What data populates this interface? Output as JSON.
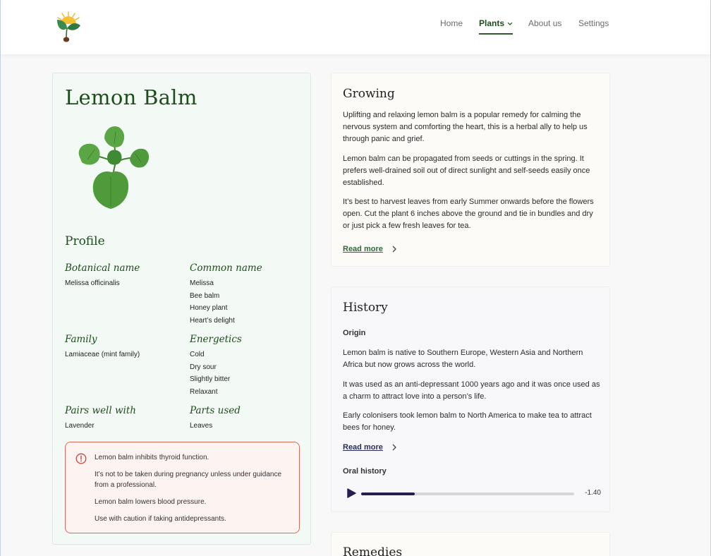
{
  "nav": {
    "items": [
      {
        "label": "Home",
        "active": false
      },
      {
        "label": "Plants",
        "active": true,
        "has_dropdown": true
      },
      {
        "label": "About us",
        "active": false
      },
      {
        "label": "Settings",
        "active": false
      }
    ]
  },
  "plant": {
    "name": "Lemon Balm",
    "profile_title": "Profile",
    "profile": {
      "botanical": {
        "label": "Botanical name",
        "values": [
          "Melissa officinalis"
        ]
      },
      "common": {
        "label": "Common name",
        "values": [
          "Melissa",
          "Bee balm",
          "Honey plant",
          "Heart’s delight"
        ]
      },
      "family": {
        "label": "Family",
        "values": [
          "Lamiaceae (mint family)"
        ]
      },
      "energetics": {
        "label": "Energetics",
        "values": [
          "Cold",
          "Dry sour",
          "Slightly bitter",
          "Relaxant"
        ]
      },
      "pairs": {
        "label": "Pairs well with",
        "values": [
          "Lavender"
        ]
      },
      "parts": {
        "label": "Parts used",
        "values": [
          "Leaves"
        ]
      }
    },
    "warnings": [
      "Lemon balm inhibits thyroid function.",
      "It’s not to be taken during pregnancy unless under guidance from a professional.",
      "Lemon balm lowers blood pressure.",
      "Use with caution if taking antidepressants."
    ]
  },
  "growing": {
    "title": "Growing",
    "paragraphs": [
      "Uplifting and relaxing lemon balm is a popular remedy for calming the nervous system and comforting the heart,  this is a herbal ally to help us through panic and grief.",
      "Lemon balm can be propagated from seeds or cuttings in the spring.  It prefers well-drained soil out of direct sunlight and self-seeds easily once established.",
      "It’s best to harvest leaves from early Summer onwards before the flowers open. Cut the plant 6 inches above the ground and tie in bundles and dry or just pick a few fresh leaves for tea."
    ],
    "read_more": "Read more"
  },
  "history": {
    "title": "History",
    "origin_label": "Origin",
    "paragraphs": [
      "Lemon balm is native to Southern Europe, Western Asia and Northern Africa but now grows across the world.",
      "It was used as an anti-depressant 1000 years ago and it was once used as a charm to attract love into a person’s life.",
      "Early colonisers took lemon balm to North America to make tea to attract bees for honey."
    ],
    "read_more": "Read more",
    "oral_history_label": "Oral history",
    "audio": {
      "remaining": "-1.40",
      "progress": 0.25
    }
  },
  "remedies": {
    "title": "Remedies"
  },
  "colors": {
    "brand_green": "#1d4d1d",
    "warning_red": "#d96a5c",
    "audio_fill": "#23204f"
  },
  "icons": {
    "logo": "sprout-sun-logo",
    "warning": "exclamation-circle-icon",
    "chevron": "chevron-right-icon",
    "play": "play-icon"
  }
}
